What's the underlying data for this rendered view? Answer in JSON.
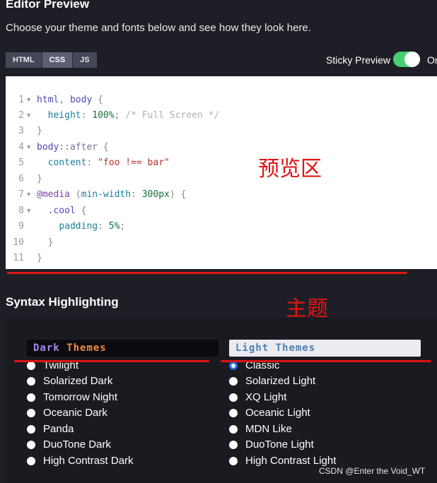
{
  "header": {
    "title": "Editor Preview",
    "subtitle": "Choose your theme and fonts below and see how they look here."
  },
  "tabs": [
    {
      "label": "HTML",
      "active": false
    },
    {
      "label": "CSS",
      "active": true
    },
    {
      "label": "JS",
      "active": false
    }
  ],
  "sticky_preview": {
    "label": "Sticky Preview",
    "state": "On",
    "enabled": true,
    "color": "#47cf73"
  },
  "code": {
    "line_numbers": [
      "1",
      "2",
      "3",
      "4",
      "5",
      "6",
      "7",
      "8",
      "9",
      "10",
      "11"
    ],
    "lines": [
      "html, body {",
      "  height: 100%; /* Full Screen */",
      "}",
      "body::after {",
      "  content: \"foo !== bar\"",
      "}",
      "@media (min-width: 300px) {",
      "  .cool {",
      "    padding: 5%;",
      "  }",
      "}"
    ]
  },
  "annotations": {
    "preview_area": "预览区",
    "theme": "主题",
    "color": "#e01414"
  },
  "syntax": {
    "title": "Syntax Highlighting",
    "dark": {
      "header_word1": "Dark",
      "header_word2": "Themes",
      "options": [
        "Twilight",
        "Solarized Dark",
        "Tomorrow Night",
        "Oceanic Dark",
        "Panda",
        "DuoTone Dark",
        "High Contrast Dark"
      ]
    },
    "light": {
      "header_word1": "Light",
      "header_word2": "Themes",
      "options": [
        "Classic",
        "Solarized Light",
        "XQ Light",
        "Oceanic Light",
        "MDN Like",
        "DuoTone Light",
        "High Contrast Light"
      ],
      "selected": "Classic"
    }
  },
  "watermark": "CSDN @Enter the Void_WT"
}
